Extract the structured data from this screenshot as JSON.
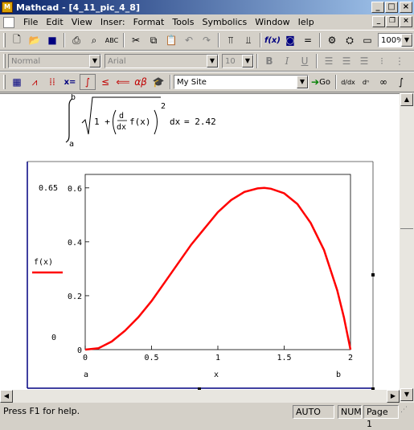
{
  "window": {
    "title": "Mathcad - [4_11_pic_4_8]"
  },
  "menu": {
    "items": [
      "File",
      "Edit",
      "View",
      "Insert",
      "Format",
      "Tools",
      "Symbolics",
      "Window",
      "Help"
    ],
    "display": [
      "File",
      "Edit",
      "View",
      "Inser:",
      "Format",
      "Tools",
      "Symbolics",
      "Window",
      "Ielp"
    ]
  },
  "format_bar": {
    "style": "Normal",
    "font": "Arial",
    "size": "10"
  },
  "math_bar": {
    "resource": "My Site",
    "go_label": "Go"
  },
  "zoom": "100%",
  "equation": {
    "upper": "b",
    "lower": "a",
    "one_plus": "1 +",
    "d_num": "d",
    "d_den": "dx",
    "func": "f(x)",
    "exp": "2",
    "dx": "dx",
    "result": "= 2.42"
  },
  "chart_data": {
    "type": "line",
    "series": [
      {
        "x": [
          0,
          0.1,
          0.2,
          0.3,
          0.4,
          0.5,
          0.6,
          0.7,
          0.8,
          0.9,
          1.0,
          1.1,
          1.2,
          1.3,
          1.35,
          1.4,
          1.5,
          1.6,
          1.7,
          1.8,
          1.9,
          1.95,
          2.0
        ],
        "y": [
          0,
          0.005,
          0.03,
          0.07,
          0.12,
          0.18,
          0.25,
          0.32,
          0.39,
          0.45,
          0.51,
          0.555,
          0.585,
          0.598,
          0.6,
          0.597,
          0.58,
          0.54,
          0.47,
          0.37,
          0.22,
          0.12,
          0.0
        ],
        "color": "#ff0000"
      }
    ],
    "xlim": [
      0,
      2
    ],
    "ylim": [
      0,
      0.65
    ],
    "xticks": [
      "0",
      "0.5",
      "1",
      "1.5",
      "2"
    ],
    "yticks": [
      "0",
      "0.2",
      "0.4",
      "0.6"
    ],
    "ylim_upper_label": "0.65",
    "ylim_lower_label": "0",
    "xlabel": "x",
    "ylabel": "f(x)",
    "x_range_left": "a",
    "x_range_right": "b",
    "grid": false
  },
  "status": {
    "help": "Press F1 for help.",
    "mode": "AUTO",
    "num": "NUM",
    "page": "Page 1"
  }
}
